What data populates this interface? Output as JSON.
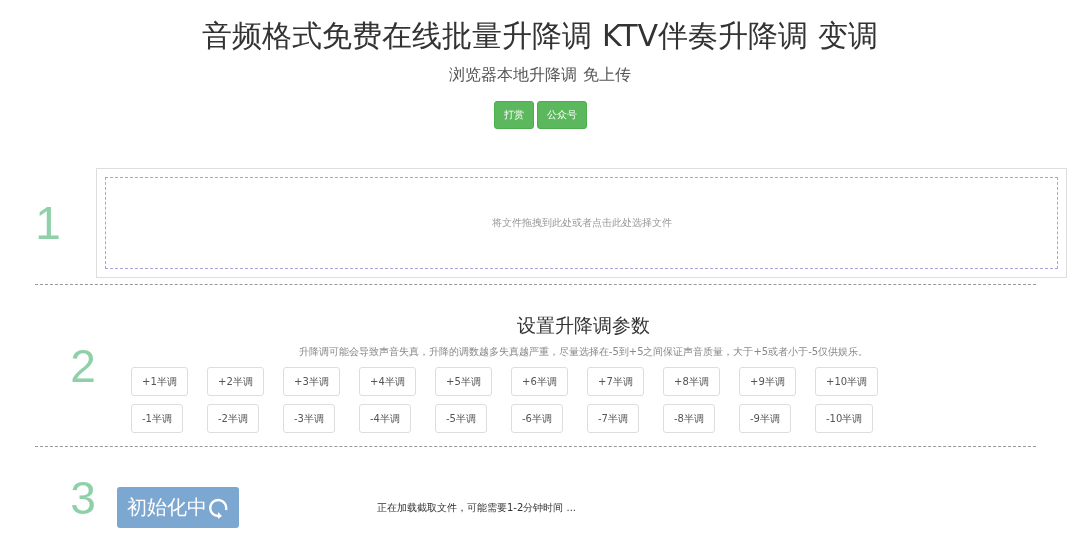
{
  "header": {
    "title": "音频格式免费在线批量升降调 KTV伴奏升降调 变调",
    "subtitle": "浏览器本地升降调 免上传",
    "buttons": [
      "打赏",
      "公众号"
    ]
  },
  "steps": [
    {
      "number": "1",
      "kind": "dropzone",
      "label": "将文件拖拽到此处或者点击此处选择文件"
    },
    {
      "number": "2",
      "kind": "pitch",
      "heading": "设置升降调参数",
      "hint": "升降调可能会导致声音失真，升降的调数越多失真越严重，尽量选择在-5到+5之间保证声音质量，大于+5或者小于-5仅供娱乐。",
      "raise": [
        "+1半调",
        "+2半调",
        "+3半调",
        "+4半调",
        "+5半调",
        "+6半调",
        "+7半调",
        "+8半调",
        "+9半调",
        "+10半调"
      ],
      "lower": [
        "-1半调",
        "-2半调",
        "-3半调",
        "-4半调",
        "-5半调",
        "-6半调",
        "-7半调",
        "-8半调",
        "-9半调",
        "-10半调"
      ]
    },
    {
      "number": "3",
      "kind": "status",
      "button": "初始化中",
      "message": "正在加载截取文件，可能需要1-2分钟时间 ..."
    }
  ]
}
